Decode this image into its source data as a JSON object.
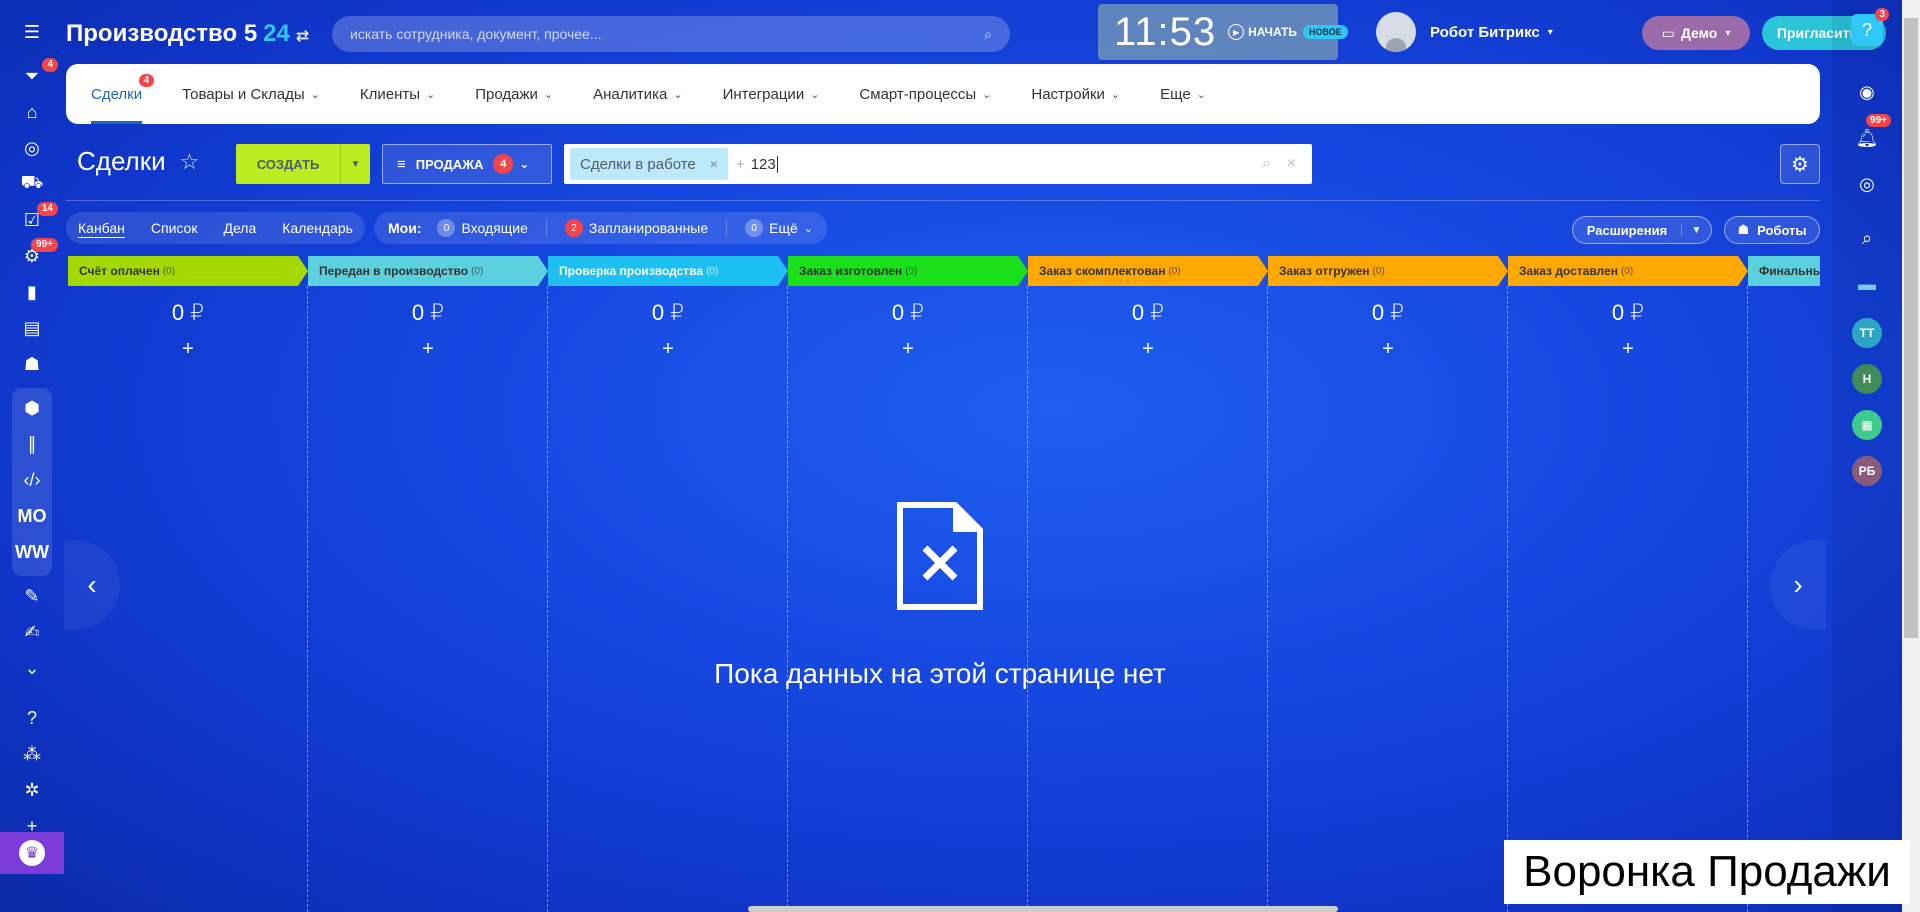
{
  "app": {
    "brand_name": "Производство 5",
    "brand_suffix": "24",
    "search_placeholder": "искать сотрудника, документ, прочее..."
  },
  "header": {
    "clock_time": "11:53",
    "start_label": "НАЧАТЬ",
    "new_badge": "НОВОЕ",
    "user_name": "Робот Битрикс",
    "demo_label": "Демо",
    "invite_label": "Пригласить"
  },
  "left_sidebar": {
    "badges": {
      "feed": "4",
      "tasks": "14",
      "chats": "99+"
    },
    "text_items": [
      "MO",
      "WW"
    ]
  },
  "right_sidebar": {
    "help_badge": "3",
    "notif_badge": "99+",
    "avatars": [
      "ТТ",
      "Н",
      "РБ"
    ]
  },
  "nav": {
    "tabs": [
      {
        "label": "Сделки",
        "badge": "4",
        "active": true
      },
      {
        "label": "Товары и Склады"
      },
      {
        "label": "Клиенты"
      },
      {
        "label": "Продажи"
      },
      {
        "label": "Аналитика"
      },
      {
        "label": "Интеграции"
      },
      {
        "label": "Смарт-процессы"
      },
      {
        "label": "Настройки"
      },
      {
        "label": "Еще"
      }
    ]
  },
  "toolbar": {
    "page_title": "Сделки",
    "create_label": "СОЗДАТЬ",
    "funnel_label": "ПРОДАЖА",
    "funnel_count": "4",
    "filter_chip": "Сделки в работе",
    "filter_plus": "+",
    "filter_text": "123"
  },
  "views": {
    "items": [
      "Канбан",
      "Список",
      "Дела",
      "Календарь"
    ],
    "my_label": "Мои:",
    "incoming_count": "0",
    "incoming_label": "Входящие",
    "planned_count": "2",
    "planned_label": "Запланированные",
    "more_count": "0",
    "more_label": "Ещё",
    "extensions_label": "Расширения",
    "robots_label": "Роботы"
  },
  "kanban": {
    "columns": [
      {
        "title": "Счёт оплачен",
        "count": "(0)",
        "sum": "0 ₽",
        "color": "#a3d900"
      },
      {
        "title": "Передан в производство",
        "count": "(0)",
        "sum": "0 ₽",
        "color": "#5bd0df"
      },
      {
        "title": "Проверка производства",
        "count": "(0)",
        "sum": "0 ₽",
        "color": "#1ec0f2"
      },
      {
        "title": "Заказ изготовлен",
        "count": "(0)",
        "sum": "0 ₽",
        "color": "#1ae01a"
      },
      {
        "title": "Заказ скомплектован",
        "count": "(0)",
        "sum": "0 ₽",
        "color": "#ffa800"
      },
      {
        "title": "Заказ отгружен",
        "count": "(0)",
        "sum": "0 ₽",
        "color": "#ffa800"
      },
      {
        "title": "Заказ доставлен",
        "count": "(0)",
        "sum": "0 ₽",
        "color": "#ffa800"
      },
      {
        "title": "Финальны",
        "count": "",
        "sum": "",
        "color": "#5bd0df"
      }
    ],
    "add_symbol": "+",
    "empty_message": "Пока данных на этой странице нет"
  },
  "caption": "Воронка Продажи"
}
